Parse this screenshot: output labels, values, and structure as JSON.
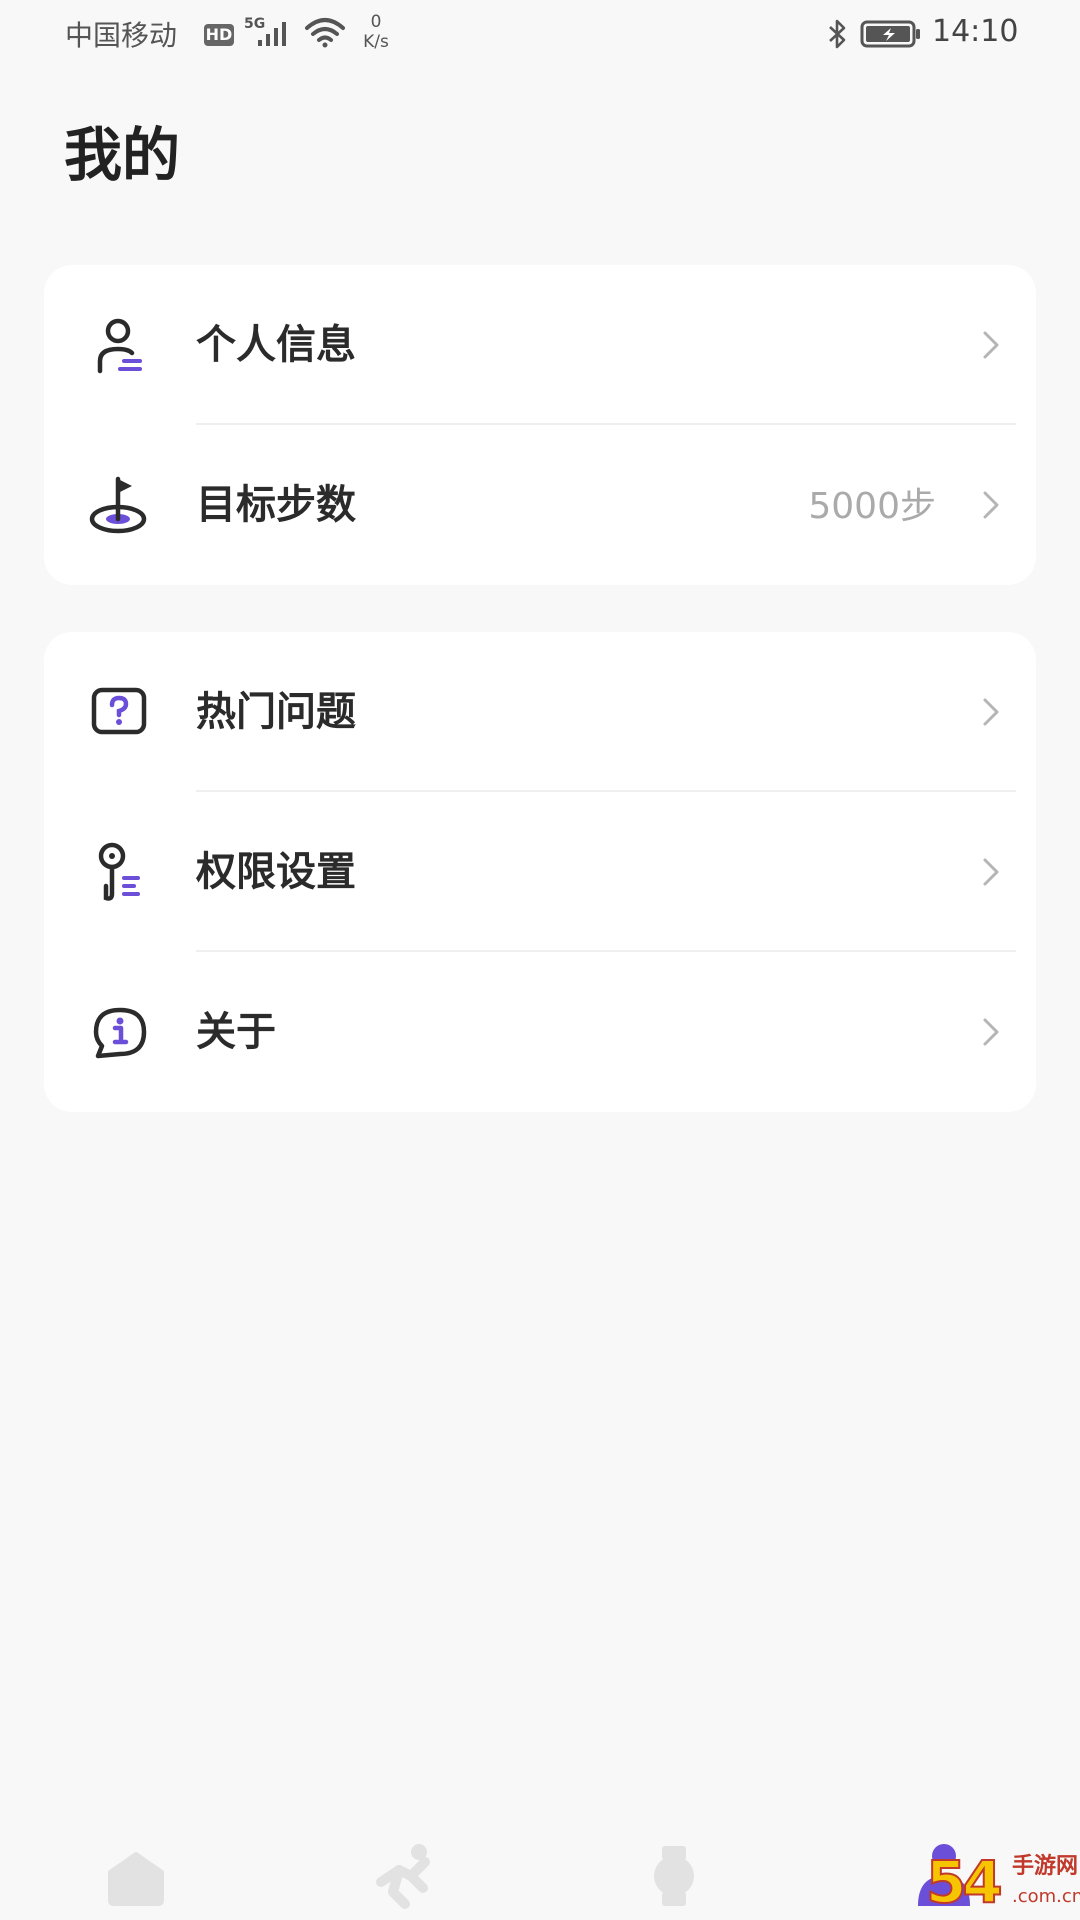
{
  "status_bar": {
    "carrier": "中国移动",
    "hd": "HD",
    "network": "5G",
    "speed_value": "0",
    "speed_unit": "K/s",
    "time": "14:10"
  },
  "page": {
    "title": "我的"
  },
  "card_1": {
    "items": [
      {
        "label": "个人信息",
        "icon": "user-profile-icon"
      },
      {
        "label": "目标步数",
        "value": "5000步",
        "icon": "target-flag-icon"
      }
    ]
  },
  "card_2": {
    "items": [
      {
        "label": "热门问题",
        "icon": "question-icon"
      },
      {
        "label": "权限设置",
        "icon": "key-icon"
      },
      {
        "label": "关于",
        "icon": "info-icon"
      }
    ]
  },
  "bottom_nav": {
    "items": [
      {
        "name": "home",
        "icon": "home-icon"
      },
      {
        "name": "sport",
        "icon": "run-icon"
      },
      {
        "name": "device",
        "icon": "watch-icon"
      },
      {
        "name": "me",
        "icon": "person-icon",
        "active": true
      }
    ]
  },
  "colors": {
    "accent": "#6b4fd8",
    "icon_dark": "#2b2b2b",
    "nav_inactive": "#e2e2e2",
    "chevron": "#b5b5b5"
  },
  "watermark": {
    "number": "54",
    "text": "手游网",
    "domain": ".com.cn"
  }
}
